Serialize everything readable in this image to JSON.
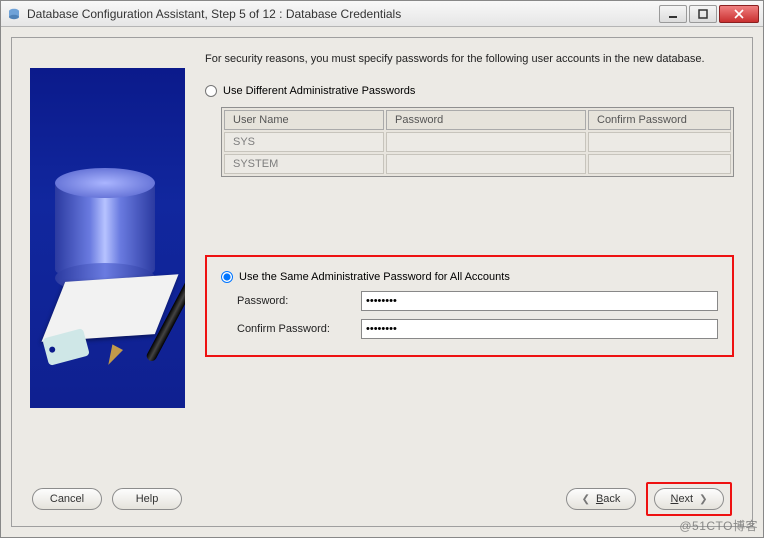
{
  "window": {
    "title": "Database Configuration Assistant, Step 5 of 12 : Database Credentials"
  },
  "instruction": "For security reasons, you must specify passwords for the following user accounts in the new database.",
  "radios": {
    "different": {
      "label": "Use Different Administrative Passwords",
      "selected": false
    },
    "same": {
      "label": "Use the Same Administrative Password for All Accounts",
      "selected": true
    }
  },
  "table": {
    "headers": {
      "user": "User Name",
      "password": "Password",
      "confirm": "Confirm Password"
    },
    "rows": [
      {
        "user": "SYS",
        "password": "",
        "confirm": ""
      },
      {
        "user": "SYSTEM",
        "password": "",
        "confirm": ""
      }
    ]
  },
  "fields": {
    "password_label": "Password:",
    "confirm_label": "Confirm Password:",
    "password_value": "********",
    "confirm_value": "********"
  },
  "buttons": {
    "cancel": "Cancel",
    "help": "Help",
    "back": "Back",
    "next": "Next"
  },
  "watermark": "@51CTO博客"
}
